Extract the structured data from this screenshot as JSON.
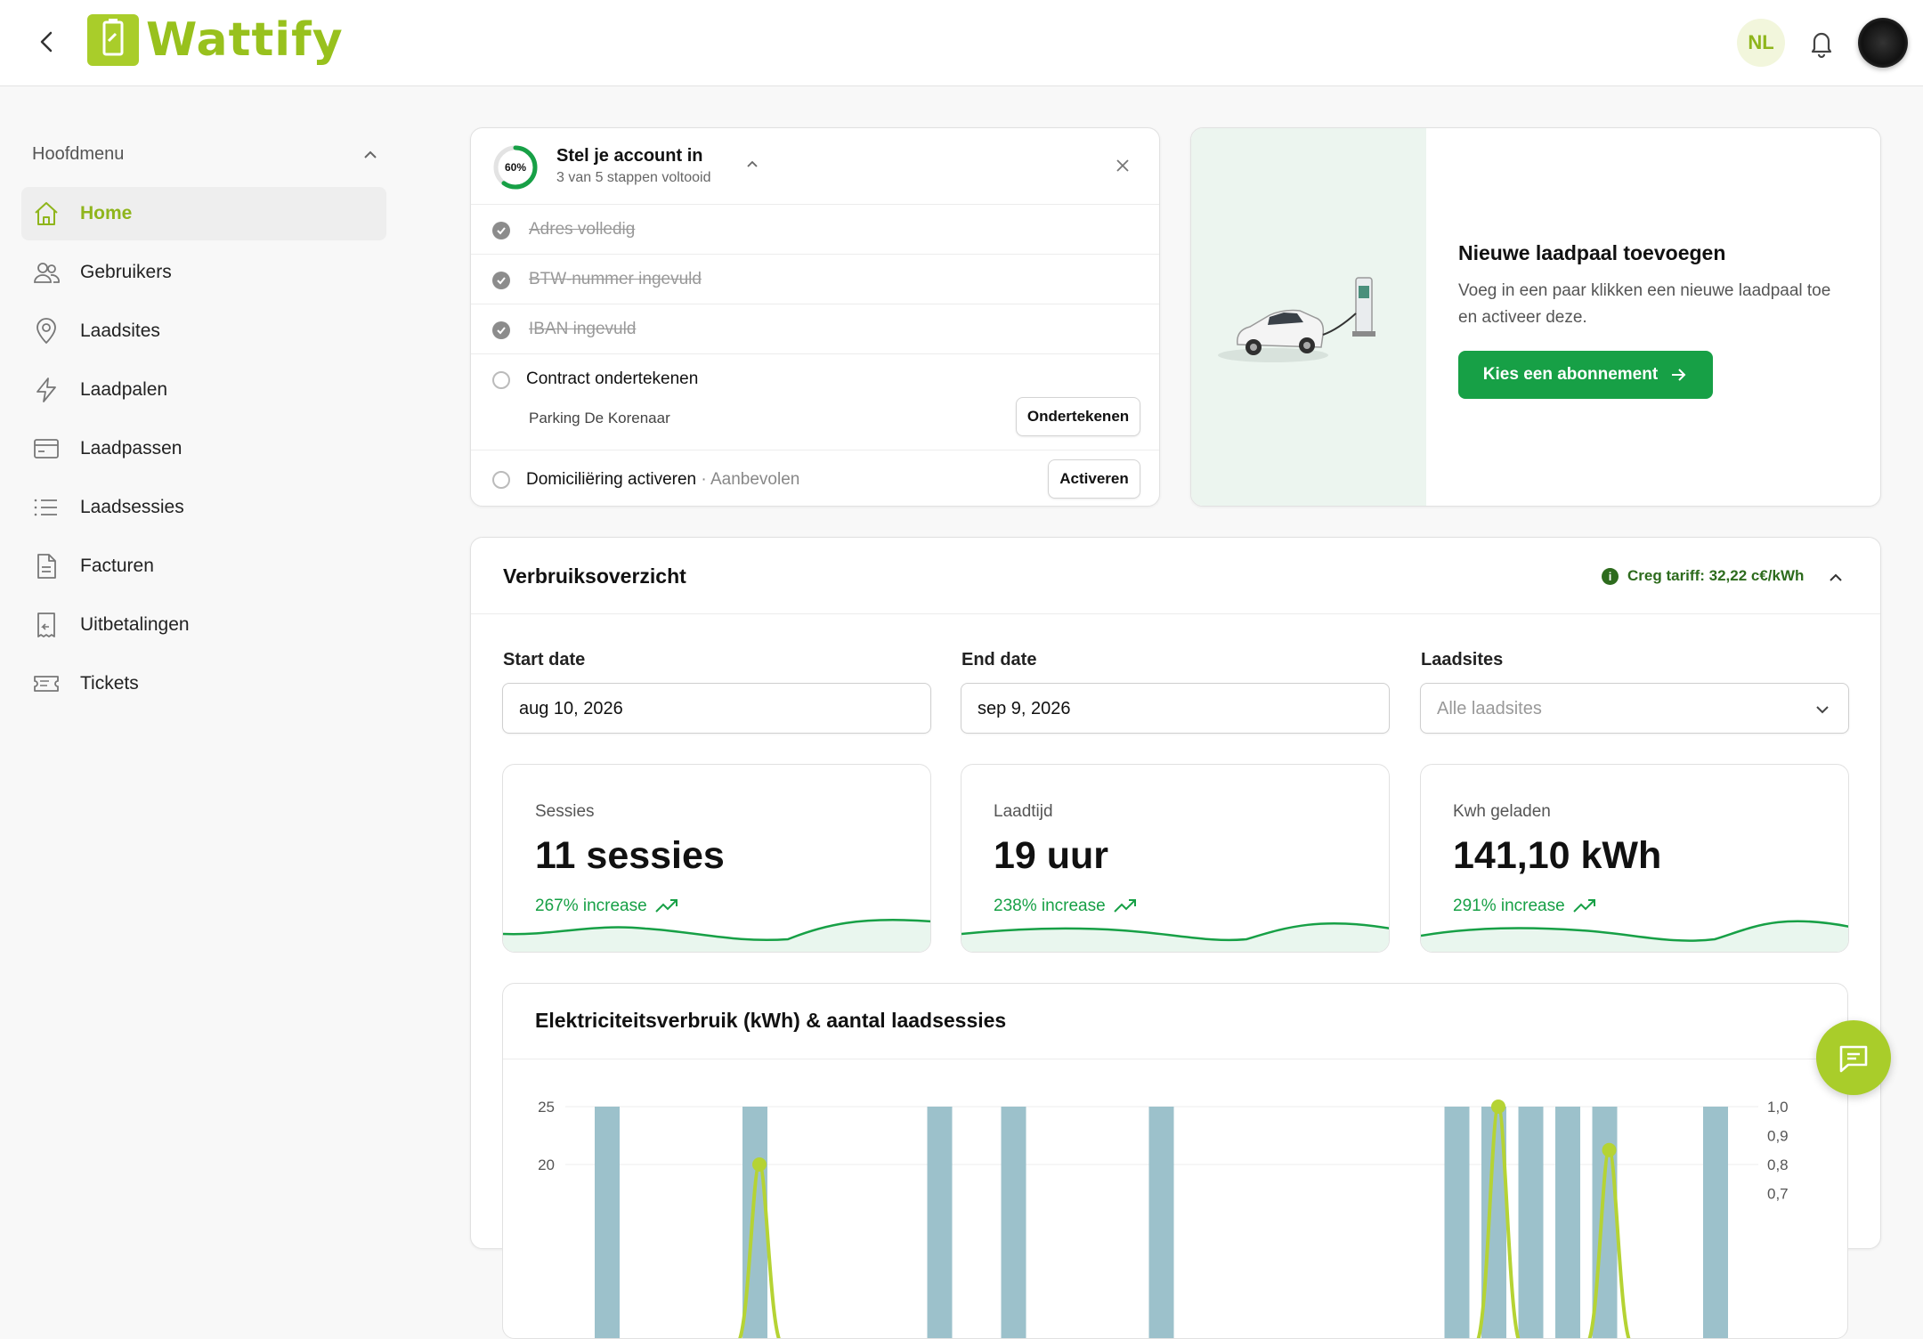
{
  "header": {
    "app_name": "Wattify",
    "language": "NL"
  },
  "sidebar": {
    "title": "Hoofdmenu",
    "items": [
      {
        "label": "Home",
        "icon": "home-icon",
        "active": true
      },
      {
        "label": "Gebruikers",
        "icon": "users-icon"
      },
      {
        "label": "Laadsites",
        "icon": "map-pin-icon"
      },
      {
        "label": "Laadpalen",
        "icon": "lightning-icon"
      },
      {
        "label": "Laadpassen",
        "icon": "credit-card-icon"
      },
      {
        "label": "Laadsessies",
        "icon": "list-icon"
      },
      {
        "label": "Facturen",
        "icon": "document-icon"
      },
      {
        "label": "Uitbetalingen",
        "icon": "receipt-icon"
      },
      {
        "label": "Tickets",
        "icon": "ticket-icon"
      }
    ]
  },
  "setup": {
    "progress": "60%",
    "progress_fraction": 0.6,
    "title": "Stel je account in",
    "subtitle": "3 van 5 stappen voltooid",
    "steps": [
      {
        "label": "Adres volledig",
        "done": true
      },
      {
        "label": "BTW-nummer ingevuld",
        "done": true
      },
      {
        "label": "IBAN ingevuld",
        "done": true
      },
      {
        "label": "Contract ondertekenen",
        "done": false,
        "detail": "Parking De Korenaar",
        "action": "Ondertekenen"
      },
      {
        "label": "Domiciliëring activeren",
        "done": false,
        "tag": "· Aanbevolen",
        "action": "Activeren"
      }
    ]
  },
  "promo": {
    "title": "Nieuwe laadpaal toevoegen",
    "text": "Voeg in een paar klikken een nieuwe laadpaal toe en activeer deze.",
    "button": "Kies een abonnement"
  },
  "usage": {
    "title": "Verbruiksoverzicht",
    "tariff": "Creg tariff: 32,22 c€/kWh",
    "filters": {
      "start_label": "Start date",
      "start_value": "aug 10, 2026",
      "end_label": "End date",
      "end_value": "sep 9, 2026",
      "sites_label": "Laadsites",
      "sites_placeholder": "Alle laadsites"
    },
    "stats": [
      {
        "label": "Sessies",
        "value": "11 sessies",
        "trend": "267% increase"
      },
      {
        "label": "Laadtijd",
        "value": "19 uur",
        "trend": "238% increase"
      },
      {
        "label": "Kwh geladen",
        "value": "141,10 kWh",
        "trend": "291% increase"
      }
    ]
  },
  "colors": {
    "brand": "#a9cd2a",
    "brand_text": "#8fb51c",
    "primary_button": "#17a046",
    "bar": "#9cc1cb",
    "line": "#b5d334"
  },
  "chart_data": {
    "type": "bar",
    "title": "Elektriciteitsverbruik (kWh) & aantal laadsessies",
    "left_axis_ticks": [
      "25",
      "20"
    ],
    "right_axis_ticks": [
      "1,0",
      "0,9",
      "0,8",
      "0,7"
    ],
    "bar_slots": [
      1,
      5,
      10,
      12,
      16,
      24,
      25,
      26,
      27,
      28,
      31
    ],
    "line_peaks": [
      {
        "slot": 5,
        "value": 0.8
      },
      {
        "slot": 25,
        "value": 1.0
      },
      {
        "slot": 28,
        "value": 0.85
      }
    ]
  }
}
